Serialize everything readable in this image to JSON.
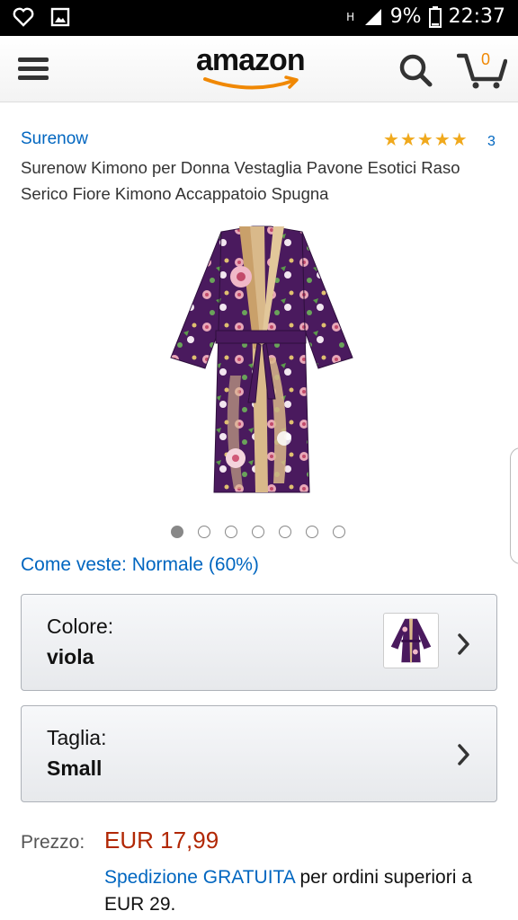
{
  "status_bar": {
    "net_letter": "H",
    "battery": "9%",
    "time": "22:37"
  },
  "header": {
    "logo_text": "amazon",
    "cart_count": "0"
  },
  "product": {
    "brand": "Surenow",
    "rating_count": "3",
    "rating_stars": 5,
    "title": "Surenow Kimono per Donna Vestaglia Pavone Esotici Raso Serico Fiore Kimono Accappatoio Spugna",
    "image_count": 7,
    "active_image": 0
  },
  "fit": {
    "text": "Come veste: Normale (60%)"
  },
  "color_selector": {
    "label": "Colore:",
    "value": "viola"
  },
  "size_selector": {
    "label": "Taglia:",
    "value": "Small"
  },
  "price": {
    "label": "Prezzo:",
    "value": "EUR 17,99"
  },
  "shipping": {
    "link_text": "Spedizione GRATUITA",
    "rest_text": " per ordini superiori a EUR 29."
  },
  "colors": {
    "link": "#0066c0",
    "price": "#b12704",
    "star": "#f0a91d",
    "accent": "#f08804",
    "robe": "#4a1a5e"
  }
}
